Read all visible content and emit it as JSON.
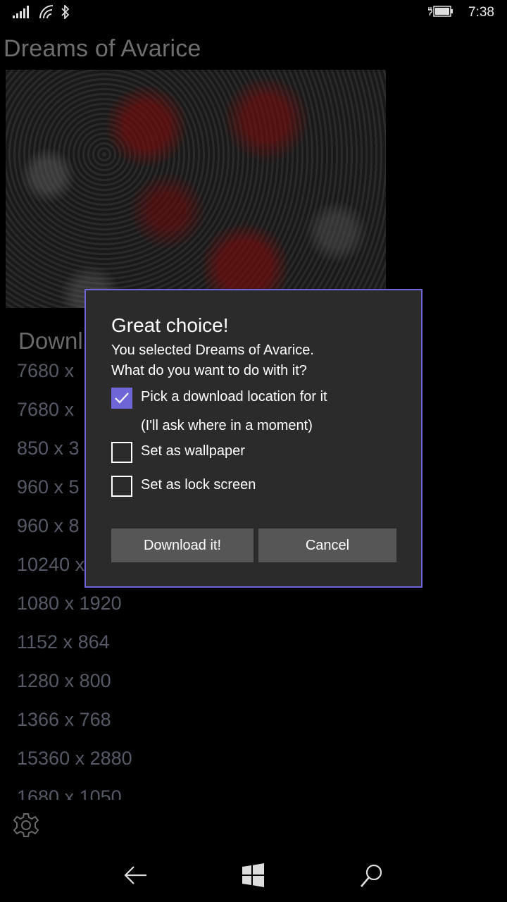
{
  "status_bar": {
    "time": "7:38",
    "icons": [
      "signal-icon",
      "wifi-icon",
      "bluetooth-icon",
      "battery-charging-icon"
    ]
  },
  "app": {
    "title": "Dreams of Avarice",
    "artwork_icon": "artwork-thumbnail",
    "download_heading": "Downl",
    "resolutions": [
      "7680 x",
      "7680 x",
      "850 x 3",
      "960 x 5",
      "960 x 8",
      "10240 x",
      "1080 x 1920",
      "1152 x 864",
      "1280 x 800",
      "1366 x 768",
      "15360 x 2880",
      "1680 x 1050"
    ],
    "settings_icon": "gear-icon"
  },
  "dialog": {
    "title": "Great choice!",
    "line1": "You selected Dreams of Avarice.",
    "line2": "What do you want to do with it?",
    "options": [
      {
        "label": "Pick a download location for it",
        "checked": true
      },
      {
        "label": "Set as wallpaper",
        "checked": false
      },
      {
        "label": "Set as lock screen",
        "checked": false
      }
    ],
    "hint": "(I'll ask where in a moment)",
    "primary_button": "Download it!",
    "secondary_button": "Cancel",
    "accent_color": "#6e66d6"
  },
  "nav_bar": {
    "icons": [
      "back-arrow-icon",
      "windows-start-icon",
      "search-icon"
    ]
  }
}
